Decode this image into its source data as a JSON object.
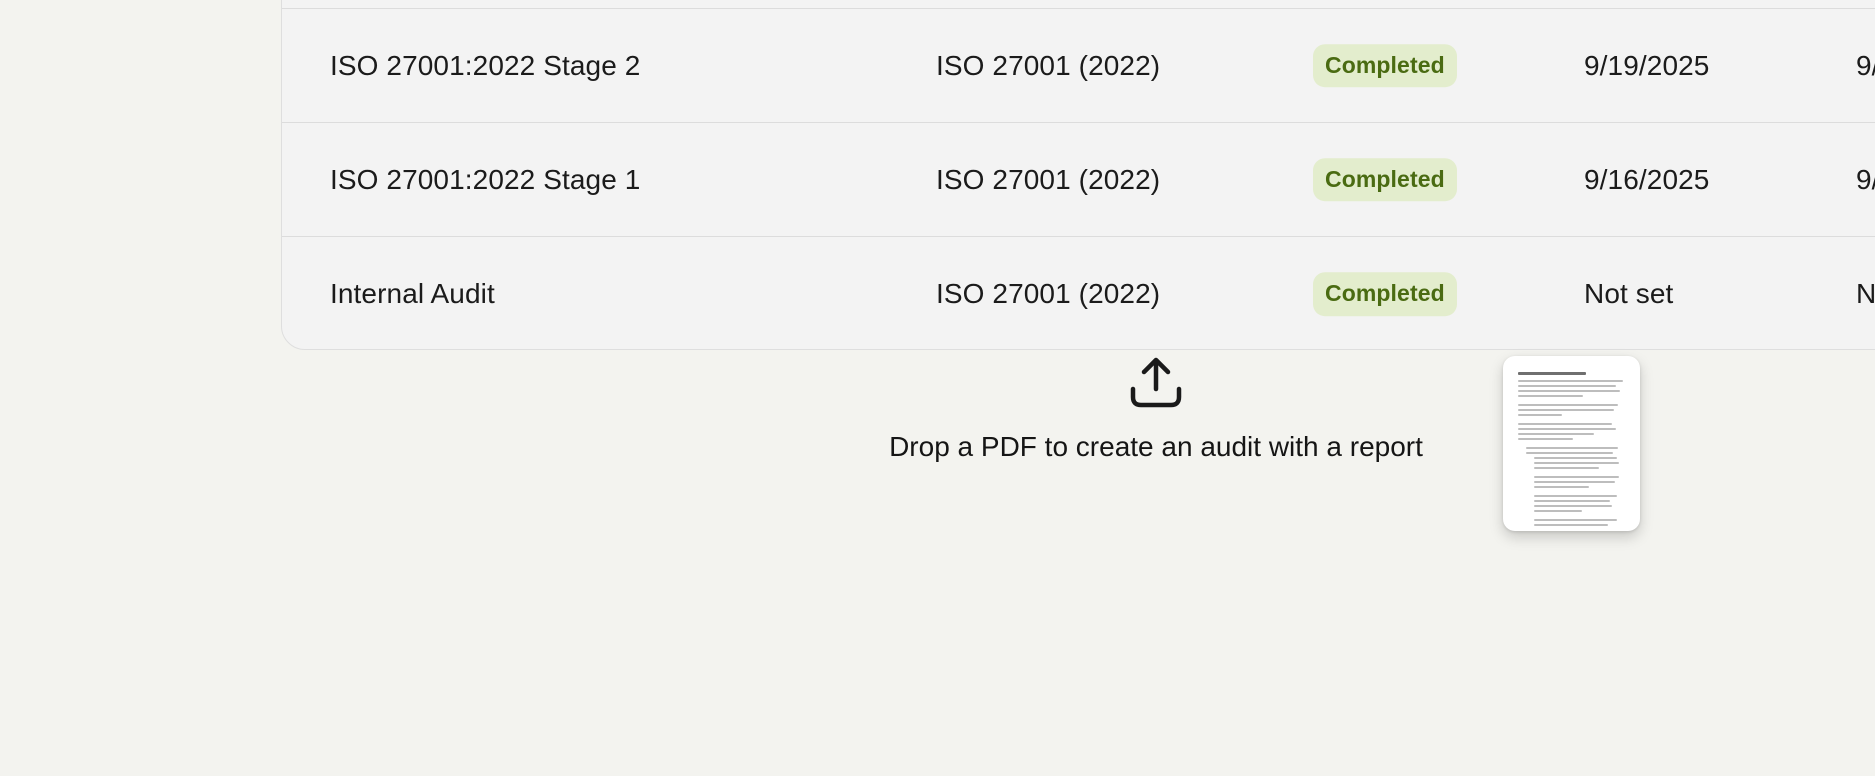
{
  "audits_table": {
    "rows": [
      {
        "name": "ISO 27001:2022 Stage 2",
        "framework": "ISO 27001 (2022)",
        "status": "Completed",
        "start_date": "9/19/2025",
        "end_date_partial": "9/"
      },
      {
        "name": "ISO 27001:2022 Stage 1",
        "framework": "ISO 27001 (2022)",
        "status": "Completed",
        "start_date": "9/16/2025",
        "end_date_partial": "9/"
      },
      {
        "name": "Internal Audit",
        "framework": "ISO 27001 (2022)",
        "status": "Completed",
        "start_date": "Not set",
        "end_date_partial": "N"
      }
    ]
  },
  "drop_zone": {
    "icon": "upload-icon",
    "text": "Drop a PDF to create an audit with a report"
  },
  "dragged_file": {
    "icon": "pdf-document-thumbnail"
  },
  "colors": {
    "background": "#f3f3ef",
    "badge_bg": "#e3edcd",
    "badge_text": "#4a6b12"
  }
}
